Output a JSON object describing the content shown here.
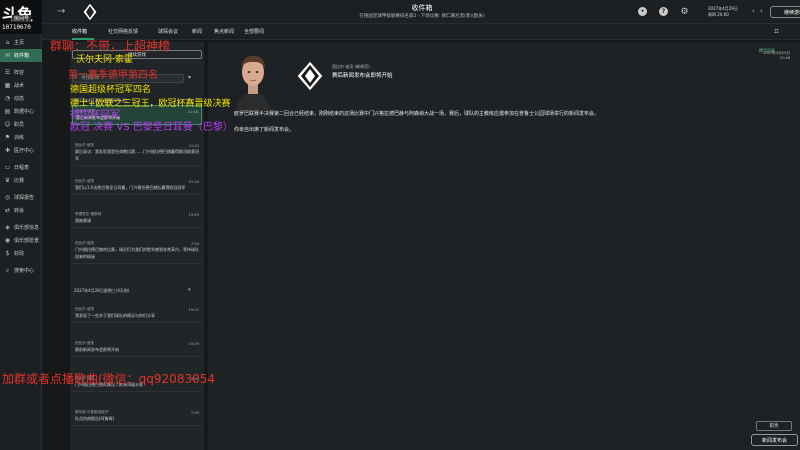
{
  "logo": {
    "main": "斗鱼",
    "sub": "房间号",
    "room_id": "10710670"
  },
  "sidebar": {
    "items": [
      {
        "label": "主页",
        "icon": "home-icon"
      },
      {
        "label": "收件箱",
        "icon": "inbox-icon",
        "active": true
      },
      {
        "label": "阵容",
        "icon": "squad-icon"
      },
      {
        "label": "战术",
        "icon": "tactics-icon"
      },
      {
        "label": "动态",
        "icon": "dynamics-icon"
      },
      {
        "label": "数据中心",
        "icon": "data-hub-icon"
      },
      {
        "label": "职员",
        "icon": "staff-icon"
      },
      {
        "label": "训练",
        "icon": "training-icon"
      },
      {
        "label": "医疗中心",
        "icon": "medical-icon"
      },
      {
        "label": "日程表",
        "icon": "calendar-icon"
      },
      {
        "label": "比赛",
        "icon": "competitions-icon"
      },
      {
        "label": "球探报告",
        "icon": "scouting-icon"
      },
      {
        "label": "转会",
        "icon": "transfers-icon"
      },
      {
        "label": "俱乐部信息",
        "icon": "club-info-icon"
      },
      {
        "label": "俱乐部愿景",
        "icon": "club-vision-icon"
      },
      {
        "label": "财政",
        "icon": "finances-icon"
      },
      {
        "label": "搜索中心",
        "icon": "search-hub-icon"
      }
    ]
  },
  "topbar": {
    "title": "收件箱",
    "subtitle": "在德国足球甲级联赛排名第2 - 下场比赛: 拜仁慕尼黑(客)(欧关)",
    "date_line1": "2027年4月29日",
    "date_line2": "周四 20:00",
    "continue_label": "继续游戏"
  },
  "tabs": [
    "收件箱",
    "社交网络反馈",
    "球探会议",
    "新闻",
    "焦点新闻",
    "全部要闻"
  ],
  "inbox": {
    "manage_label": "继续游戏",
    "search_placeholder": "寻找新闻",
    "date_header_1": "2027年4月29日星期四(今天)",
    "date_header_2": "2027年4月28日星期三(4天前)",
    "messages": [
      {
        "sender": "西比尔·迪茨",
        "time": "21:48",
        "subject": "赛后新闻发布会即将开始",
        "selected": true
      },
      {
        "sender": "西比尔·迪茨",
        "time": "21:43",
        "subject": "赛后采访：我发现我是在调教比赛……门兴格拉德巴赫赢得欧冠联赛冠军",
        "selected": false
      },
      {
        "sender": "西比尔·迪茨",
        "time": "21:34",
        "subject": "我们以1:0击败巴黎圣日耳曼，门兴格拉德巴赫队赢得欧冠冠军",
        "selected": false
      },
      {
        "sender": "李德意志·佛斯特",
        "time": "19:49",
        "subject": "我被邀请",
        "selected": false
      },
      {
        "sender": "西比尔·迪茨",
        "time": "7:04",
        "subject": "门兴格拉德巴赫的比赛，球员们为我们的胜利感到非常高兴，等待球队回来的球迷",
        "selected": false
      },
      {
        "sender": "西比尔·迪茨",
        "time": "19:01",
        "subject": "我发现了一些关于我们球队的情况与你们分享",
        "selected": false
      },
      {
        "sender": "西比尔·迪茨",
        "time": "15:09",
        "subject": "赛前新闻发布会即将开始",
        "selected": false
      },
      {
        "sender": "西比尔·迪茨",
        "time": "3:49",
        "subject": "门兴格拉德巴赫队踢出了欧洲顶级水准",
        "selected": false
      },
      {
        "sender": "俱乐部·贝鲁斯克医疗",
        "time": "7:00",
        "subject": "队员伤病报告(阿鲁姆)",
        "selected": false
      }
    ]
  },
  "reader": {
    "from": "西比尔·迪茨 (新闻官)",
    "title": "赛后新闻发布会即将开始",
    "date_line1": "2027年4月29日",
    "date_line2": "21:48",
    "reply_label": "撰写回复",
    "body_line1": "欧罗巴联赛半决赛第二回合已经结束，刚刚结束的这场比赛中门兴格拉德巴赫与阿森纳大战一场，赛后，球队的主教练应邀参加在普鲁士公园球场举行的新闻发布会。",
    "body_line2": "你亲自出席了新闻发布会。",
    "pill_label": "职责",
    "action_label": "新闻发布会"
  },
  "overlays": {
    "line1": "群聊：不带，上超神榜",
    "line2": "沃尔夫冈·索霍",
    "line3": "第一赛季德甲第四名",
    "line4": "德国超级杯冠军四名",
    "line5": "德士+欧联之三冠王，欧冠杯赛晋级决赛",
    "line6": "德国杯冠军",
    "line7": "欧冠 决赛 VS 巴黎圣日耳曼（巴黎）",
    "bottom": "加群或者点播歌曲(微信：qq92083054"
  },
  "colors": {
    "accent": "#2f9e6e",
    "active_bg": "#2f6e54",
    "overlay_red": "#e0332b",
    "overlay_yellow": "#f2e600",
    "overlay_purple": "#b23cf0"
  }
}
